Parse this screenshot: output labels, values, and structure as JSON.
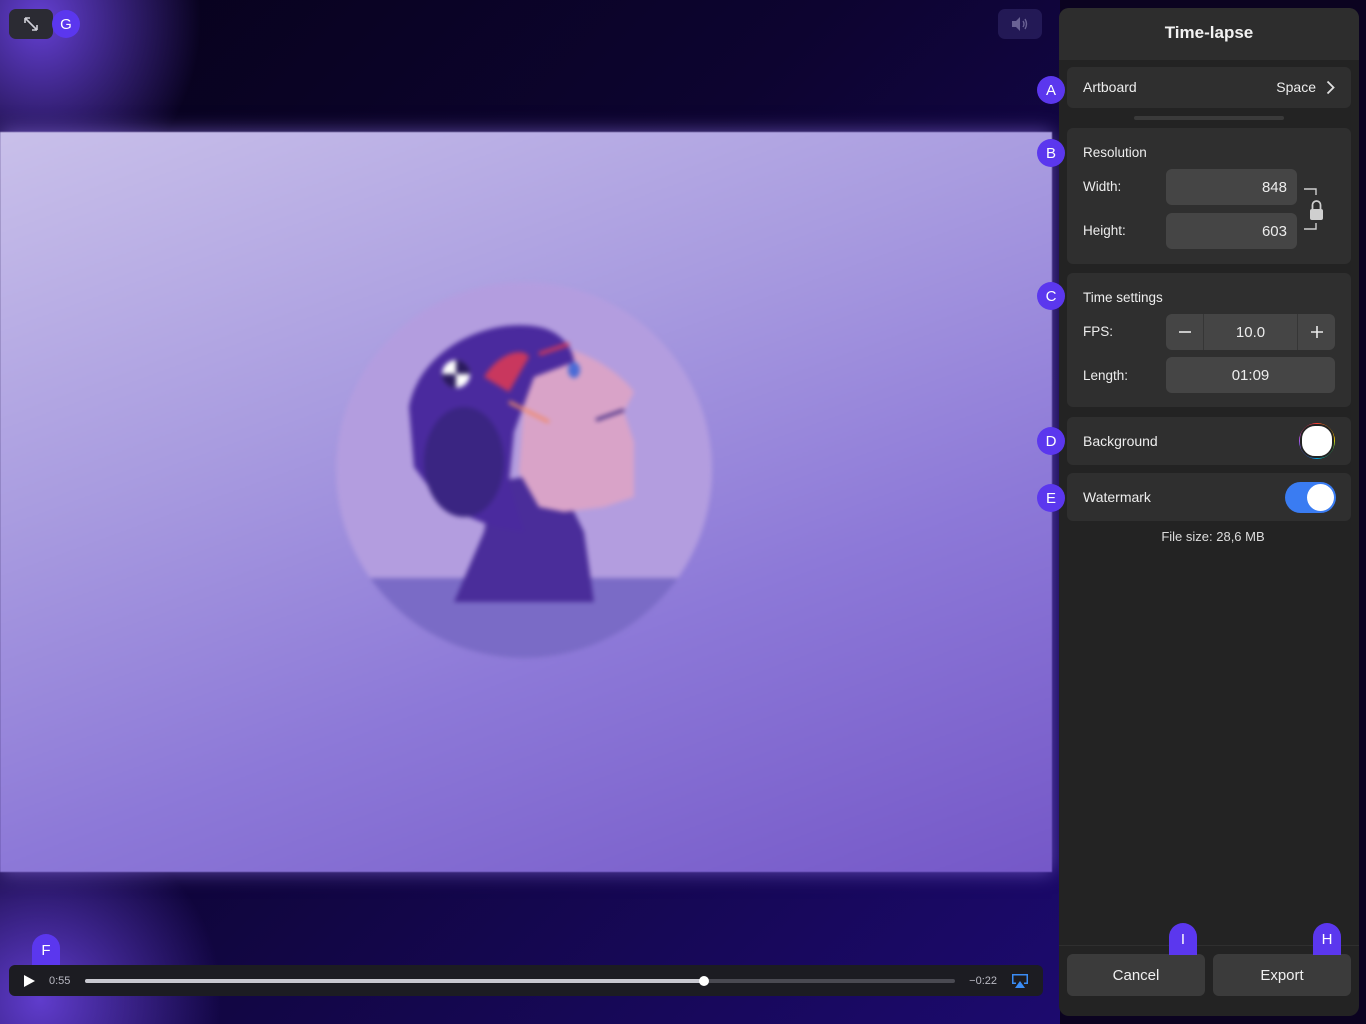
{
  "panel": {
    "title": "Time-lapse",
    "artboard": {
      "label": "Artboard",
      "value": "Space"
    },
    "resolution": {
      "label": "Resolution",
      "width_label": "Width:",
      "width_value": "848",
      "height_label": "Height:",
      "height_value": "603"
    },
    "time_settings": {
      "label": "Time settings",
      "fps_label": "FPS:",
      "fps_value": "10.0",
      "length_label": "Length:",
      "length_value": "01:09"
    },
    "background": {
      "label": "Background",
      "color": "#ffffff"
    },
    "watermark": {
      "label": "Watermark",
      "enabled": true
    },
    "file_size": "File size:  28,6 MB",
    "cancel_label": "Cancel",
    "export_label": "Export"
  },
  "player": {
    "elapsed": "0:55",
    "remaining": "−0:22",
    "progress": 0.712
  },
  "badges": {
    "a": "A",
    "b": "B",
    "c": "C",
    "d": "D",
    "e": "E",
    "f": "F",
    "g": "G",
    "h": "H",
    "i": "I"
  },
  "colors": {
    "accent": "#5b37ee",
    "toggle_on": "#3a7cf2",
    "panel_bg": "#232323"
  },
  "icons": [
    "expand-arrows-icon",
    "volume-icon",
    "chevron-right-icon",
    "lock-icon",
    "minus-icon",
    "plus-icon",
    "play-icon",
    "airplay-icon"
  ]
}
